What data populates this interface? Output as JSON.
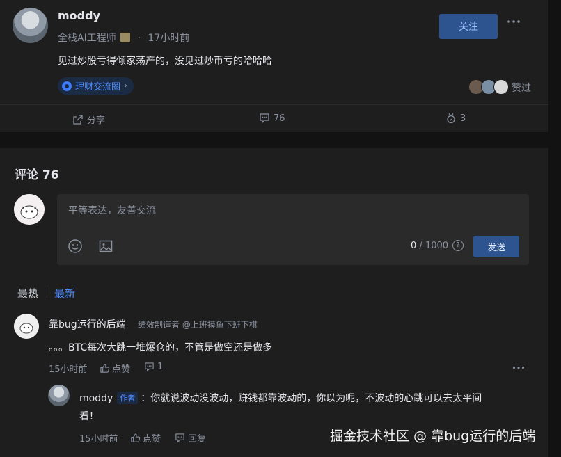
{
  "post": {
    "author": "moddy",
    "role": "全栈AI工程师",
    "separator": "·",
    "time": "17小时前",
    "content": "见过炒股亏得倾家荡产的，没见过炒币亏的哈哈哈",
    "follow_label": "关注",
    "more_icon": "more-dots-icon",
    "topic_label": "理财交流圈",
    "topic_chevron": "›",
    "liked_label": "赞过",
    "actions": {
      "share_label": "分享",
      "comment_count": "76",
      "like_count": "3"
    }
  },
  "comments": {
    "title": "评论 76",
    "editor": {
      "placeholder": "平等表达，友善交流",
      "count_current": "0",
      "count_sep": "/",
      "count_max": "1000",
      "help_icon": "?",
      "send_label": "发送"
    },
    "sort": {
      "hot": "最热",
      "new": "最新"
    },
    "items": [
      {
        "author": "靠bug运行的后端",
        "title": "绩效制造者 @上班摸鱼下班下棋",
        "text": "。。。BTC每次大跳一堆爆仓的，不管是做空还是做多",
        "time": "15小时前",
        "like_label": "点赞",
        "reply_count": "1",
        "reply": {
          "author": "moddy",
          "badge": "作者",
          "text_line1": "：你就说波动没波动，赚钱都靠波动的，你以为呢，不波动的心跳可以去太平间",
          "text_line2": "看！",
          "time": "15小时前",
          "like_label": "点赞",
          "reply_label": "回复"
        }
      }
    ]
  },
  "watermark": "掘金技术社区 @ 靠bug运行的后端",
  "colors": {
    "accent": "#4e8cff",
    "button_bg": "#2e5490",
    "card_bg": "#1e1e1e",
    "page_bg": "#121212"
  }
}
